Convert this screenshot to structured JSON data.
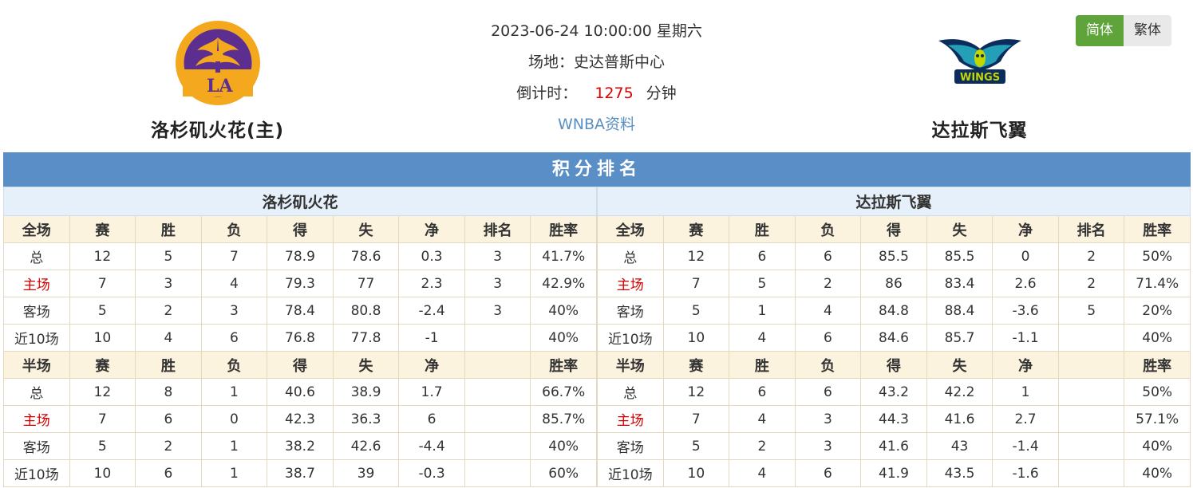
{
  "match": {
    "datetime": "2023-06-24 10:00:00 星期六",
    "venue_line": "场地：史达普斯中心",
    "countdown_label": "倒计时：",
    "countdown_value": "1275",
    "countdown_unit": "分钟",
    "league_link": "WNBA资料"
  },
  "home_team": {
    "name": "洛杉矶火花(主)",
    "short_name": "洛杉矶火花",
    "logo_text": "LA"
  },
  "away_team": {
    "name": "达拉斯飞翼",
    "short_name": "达拉斯飞翼",
    "logo_text": "WINGS"
  },
  "lang": {
    "simplified": "简体",
    "traditional": "繁体"
  },
  "colors": {
    "section_header": "#5a8ec6",
    "active_lang": "#5ea43a",
    "countdown": "#e00000",
    "home_label": "#d40000"
  },
  "standings": {
    "title": "积分排名",
    "home": {
      "full": {
        "headers": [
          "全场",
          "赛",
          "胜",
          "负",
          "得",
          "失",
          "净",
          "排名",
          "胜率"
        ],
        "rows": [
          [
            "总",
            "12",
            "5",
            "7",
            "78.9",
            "78.6",
            "0.3",
            "3",
            "41.7%"
          ],
          [
            "主场",
            "7",
            "3",
            "4",
            "79.3",
            "77",
            "2.3",
            "3",
            "42.9%"
          ],
          [
            "客场",
            "5",
            "2",
            "3",
            "78.4",
            "80.8",
            "-2.4",
            "3",
            "40%"
          ],
          [
            "近10场",
            "10",
            "4",
            "6",
            "76.8",
            "77.8",
            "-1",
            "",
            "40%"
          ]
        ]
      },
      "half": {
        "headers": [
          "半场",
          "赛",
          "胜",
          "负",
          "得",
          "失",
          "净",
          "",
          "胜率"
        ],
        "rows": [
          [
            "总",
            "12",
            "8",
            "1",
            "40.6",
            "38.9",
            "1.7",
            "",
            "66.7%"
          ],
          [
            "主场",
            "7",
            "6",
            "0",
            "42.3",
            "36.3",
            "6",
            "",
            "85.7%"
          ],
          [
            "客场",
            "5",
            "2",
            "1",
            "38.2",
            "42.6",
            "-4.4",
            "",
            "40%"
          ],
          [
            "近10场",
            "10",
            "6",
            "1",
            "38.7",
            "39",
            "-0.3",
            "",
            "60%"
          ]
        ]
      }
    },
    "away": {
      "full": {
        "headers": [
          "全场",
          "赛",
          "胜",
          "负",
          "得",
          "失",
          "净",
          "排名",
          "胜率"
        ],
        "rows": [
          [
            "总",
            "12",
            "6",
            "6",
            "85.5",
            "85.5",
            "0",
            "2",
            "50%"
          ],
          [
            "主场",
            "7",
            "5",
            "2",
            "86",
            "83.4",
            "2.6",
            "2",
            "71.4%"
          ],
          [
            "客场",
            "5",
            "1",
            "4",
            "84.8",
            "88.4",
            "-3.6",
            "5",
            "20%"
          ],
          [
            "近10场",
            "10",
            "4",
            "6",
            "84.6",
            "85.7",
            "-1.1",
            "",
            "40%"
          ]
        ]
      },
      "half": {
        "headers": [
          "半场",
          "赛",
          "胜",
          "负",
          "得",
          "失",
          "净",
          "",
          "胜率"
        ],
        "rows": [
          [
            "总",
            "12",
            "6",
            "6",
            "43.2",
            "42.2",
            "1",
            "",
            "50%"
          ],
          [
            "主场",
            "7",
            "4",
            "3",
            "44.3",
            "41.6",
            "2.7",
            "",
            "57.1%"
          ],
          [
            "客场",
            "5",
            "2",
            "3",
            "41.6",
            "43",
            "-1.4",
            "",
            "40%"
          ],
          [
            "近10场",
            "10",
            "4",
            "6",
            "41.9",
            "43.5",
            "-1.6",
            "",
            "40%"
          ]
        ]
      }
    }
  }
}
